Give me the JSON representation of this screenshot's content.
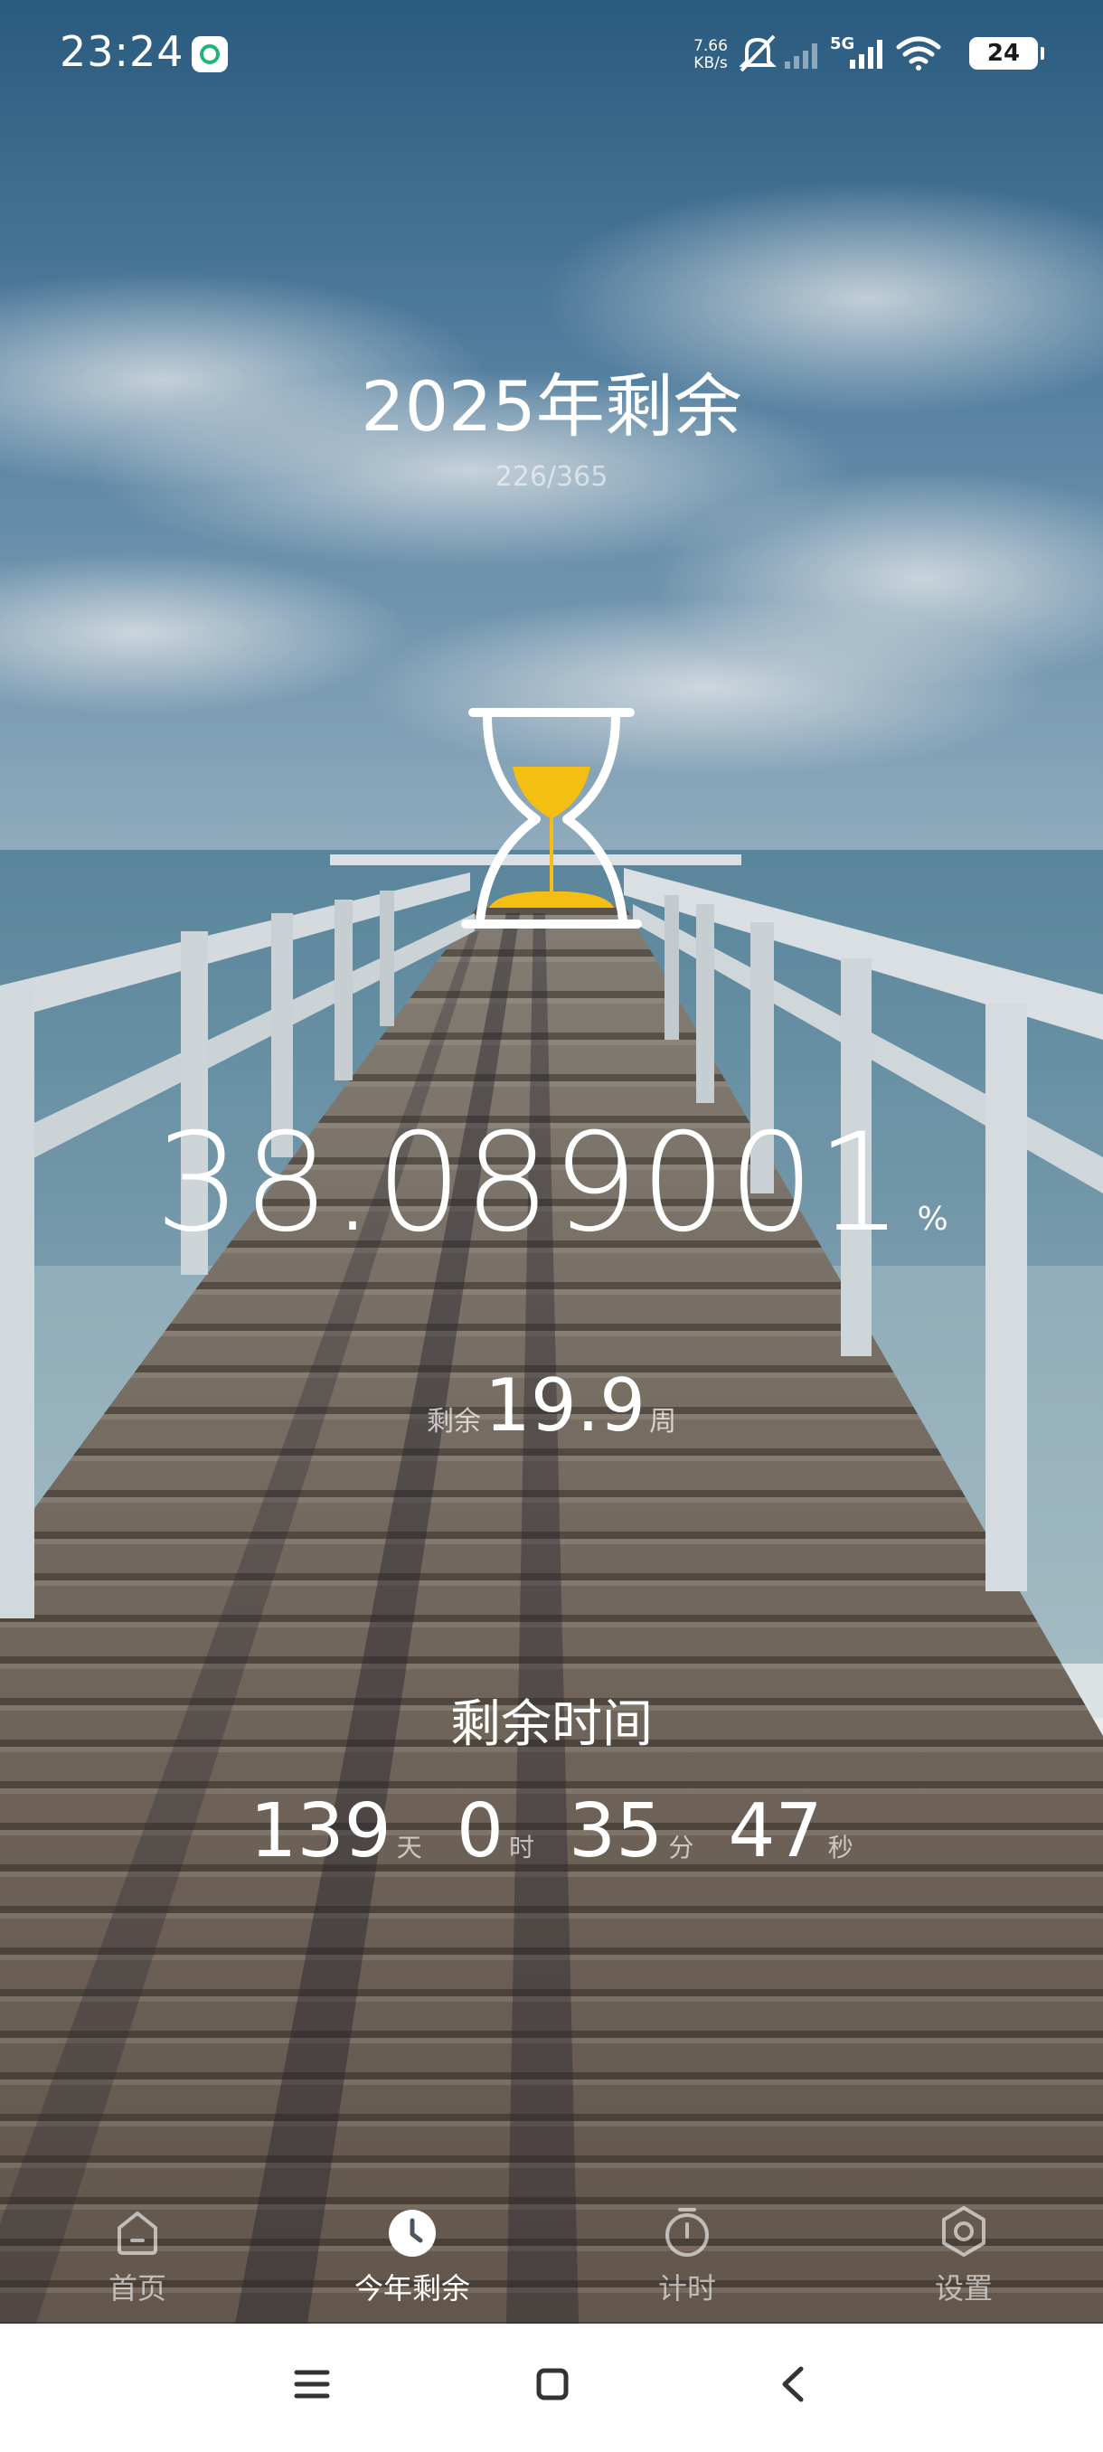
{
  "status_bar": {
    "time": "23:24",
    "net_speed_value": "7.66",
    "net_speed_unit": "KB/s",
    "network_type": "5G",
    "battery_level": "24",
    "icons": [
      "app-notification-icon",
      "bell-muted-icon",
      "signal-weak-icon",
      "signal-5g-icon",
      "wifi-icon",
      "battery-icon"
    ]
  },
  "header": {
    "title": "2025年剩余",
    "progress_count": "226/365"
  },
  "hourglass": {
    "icon": "hourglass-icon",
    "sand_color": "#F5BE12"
  },
  "percent": {
    "value": "38.089001",
    "unit": "%"
  },
  "weeks": {
    "prefix": "剩余",
    "value": "19.9",
    "unit": "周"
  },
  "remaining": {
    "title": "剩余时间",
    "days": "139",
    "days_unit": "天",
    "hours": "0",
    "hours_unit": "时",
    "minutes": "35",
    "minutes_unit": "分",
    "seconds": "47",
    "seconds_unit": "秒"
  },
  "tabs": [
    {
      "label": "首页",
      "icon": "home-icon",
      "active": false
    },
    {
      "label": "今年剩余",
      "icon": "clock-icon",
      "active": true
    },
    {
      "label": "计时",
      "icon": "stopwatch-icon",
      "active": false
    },
    {
      "label": "设置",
      "icon": "gear-icon",
      "active": false
    }
  ],
  "system_nav": [
    "menu-icon",
    "home-square-icon",
    "back-icon"
  ]
}
